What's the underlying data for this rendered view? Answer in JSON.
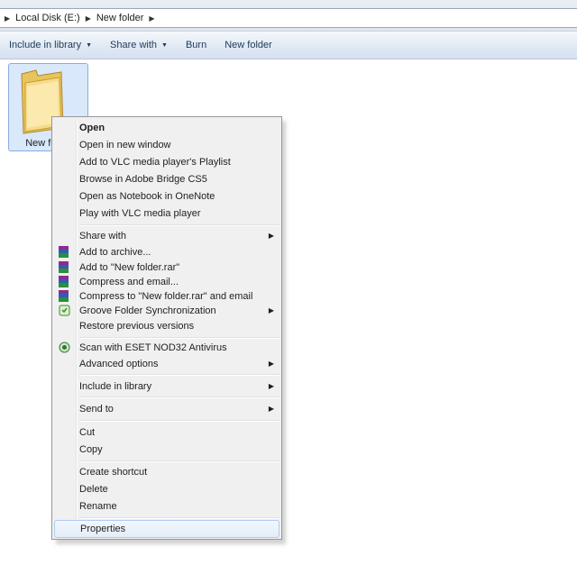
{
  "address": {
    "crumbs": [
      "Local Disk (E:)",
      "New folder"
    ]
  },
  "toolbar": {
    "include_label": "Include in library",
    "share_label": "Share with",
    "burn_label": "Burn",
    "newfolder_label": "New folder"
  },
  "folder": {
    "label": "New folder"
  },
  "menu": {
    "items": [
      {
        "label": "Open"
      },
      {
        "label": "Open in new window"
      },
      {
        "label": "Add to VLC media player's Playlist"
      },
      {
        "label": "Browse in Adobe Bridge CS5"
      },
      {
        "label": "Open as Notebook in OneNote"
      },
      {
        "label": "Play with VLC media player"
      },
      {
        "label": "Share with"
      },
      {
        "label": "Add to archive..."
      },
      {
        "label": "Add to \"New folder.rar\""
      },
      {
        "label": "Compress and email..."
      },
      {
        "label": "Compress to \"New folder.rar\" and email"
      },
      {
        "label": "Groove Folder Synchronization"
      },
      {
        "label": "Restore previous versions"
      },
      {
        "label": "Scan with ESET NOD32 Antivirus"
      },
      {
        "label": "Advanced options"
      },
      {
        "label": "Include in library"
      },
      {
        "label": "Send to"
      },
      {
        "label": "Cut"
      },
      {
        "label": "Copy"
      },
      {
        "label": "Create shortcut"
      },
      {
        "label": "Delete"
      },
      {
        "label": "Rename"
      },
      {
        "label": "Properties"
      }
    ]
  },
  "colors": {
    "selection_bg": "#d9e8fa",
    "menu_bg": "#f0f0f0",
    "toolbar_text": "#1e3b5a"
  }
}
